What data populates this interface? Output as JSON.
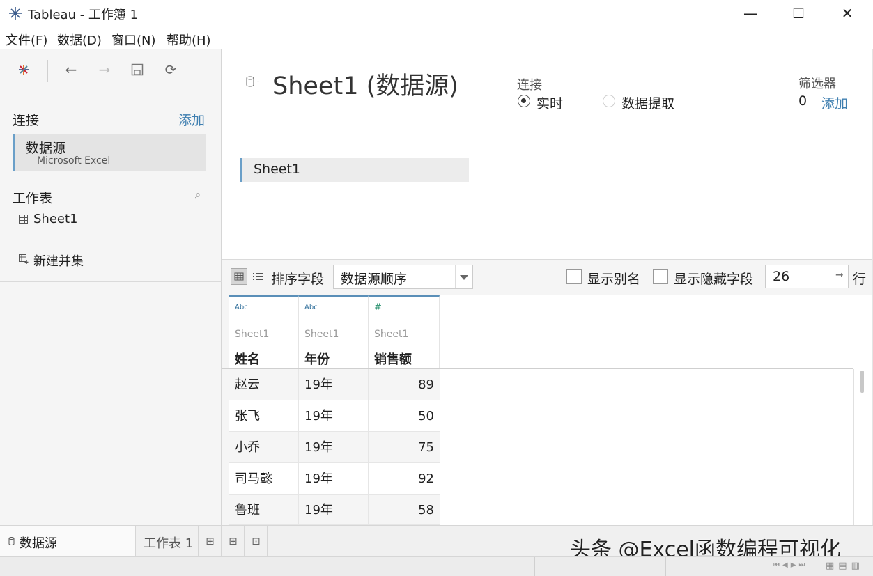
{
  "window": {
    "title": "Tableau - 工作簿 1",
    "minimize": "—",
    "maximize": "☐",
    "close": "✕"
  },
  "menu": [
    "文件(F)",
    "数据(D)",
    "窗口(N)",
    "帮助(H)"
  ],
  "left": {
    "connections_label": "连接",
    "add_label": "添加",
    "datasource_name": "数据源",
    "datasource_type": "Microsoft Excel",
    "worksheets_label": "工作表",
    "sheets": [
      "Sheet1"
    ],
    "new_union": "新建并集"
  },
  "header": {
    "title": "Sheet1 (数据源)",
    "connection_label": "连接",
    "live_label": "实时",
    "extract_label": "数据提取",
    "filters_label": "筛选器",
    "filters_count": "0",
    "filters_add": "添加"
  },
  "canvas": {
    "table_name": "Sheet1"
  },
  "grid_toolbar": {
    "sort_label": "排序字段",
    "sort_value": "数据源顺序",
    "show_alias": "显示别名",
    "show_hidden": "显示隐藏字段",
    "rows_value": "26",
    "rows_label": "行"
  },
  "columns": [
    {
      "type": "Abc",
      "source": "Sheet1",
      "name": "姓名"
    },
    {
      "type": "Abc",
      "source": "Sheet1",
      "name": "年份"
    },
    {
      "type": "#",
      "source": "Sheet1",
      "name": "销售额"
    }
  ],
  "rows": [
    [
      "赵云",
      "19年",
      "89"
    ],
    [
      "张飞",
      "19年",
      "50"
    ],
    [
      "小乔",
      "19年",
      "75"
    ],
    [
      "司马懿",
      "19年",
      "92"
    ],
    [
      "鲁班",
      "19年",
      "58"
    ]
  ],
  "tabs": {
    "datasource_tab": "数据源",
    "sheet_tab": "工作表 1"
  },
  "watermark": "头条 @Excel函数编程可视化",
  "colors": {
    "accent": "#3f7fb0",
    "column_top": "#5a8fb8",
    "row_alt": "#f5f5f5"
  }
}
